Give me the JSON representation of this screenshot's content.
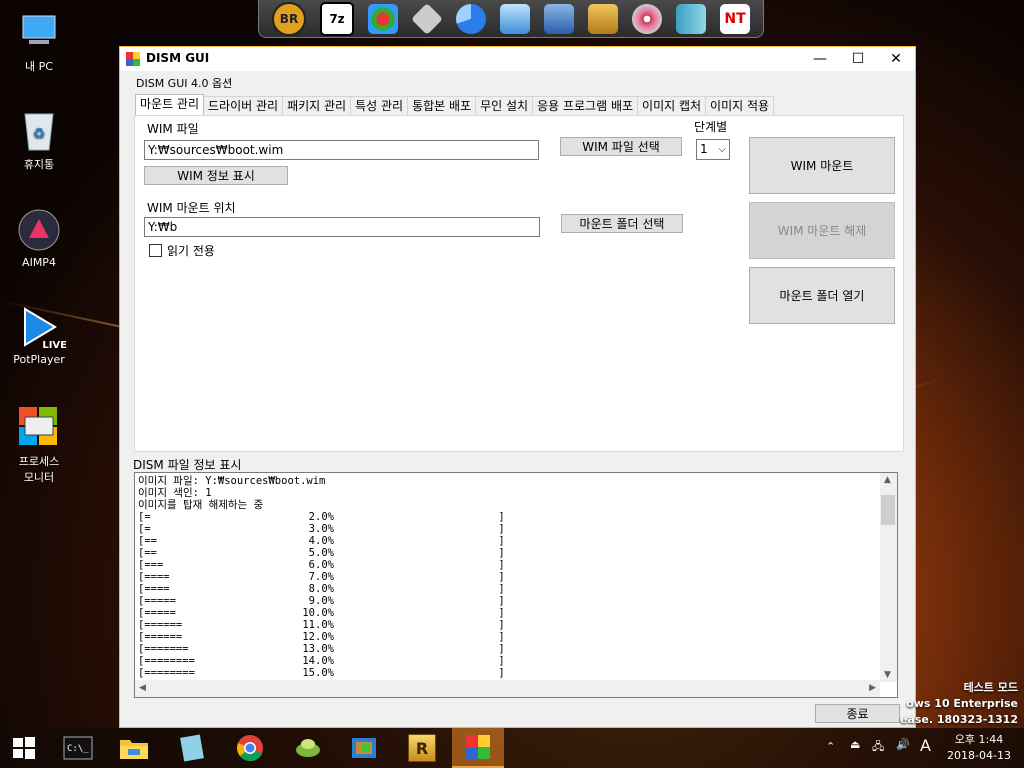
{
  "desktop": {
    "icons": [
      {
        "label": "내 PC",
        "icon": "this-pc-icon"
      },
      {
        "label": "휴지통",
        "icon": "recycle-bin-icon"
      },
      {
        "label": "AIMP4",
        "icon": "aimp-icon"
      },
      {
        "label": "PotPlayer",
        "icon": "potplayer-icon",
        "badge": "LIVE"
      },
      {
        "label": "프로세스\n모니터",
        "icon": "process-monitor-icon"
      }
    ]
  },
  "launcher": {
    "items": [
      {
        "icon": "br-icon",
        "text": "BR"
      },
      {
        "icon": "7zip-icon",
        "text": "7z"
      },
      {
        "icon": "partition-icon",
        "text": ""
      },
      {
        "icon": "disk-tool-icon",
        "text": ""
      },
      {
        "icon": "pie-chart-icon",
        "text": ""
      },
      {
        "icon": "setup-icon",
        "text": ""
      },
      {
        "icon": "network-tool-icon",
        "text": ""
      },
      {
        "icon": "archive-box-icon",
        "text": ""
      },
      {
        "icon": "disc-icon",
        "text": ""
      },
      {
        "icon": "book-icon",
        "text": ""
      },
      {
        "icon": "nt-icon",
        "text": "NT"
      }
    ]
  },
  "window": {
    "title": "DISM GUI",
    "menu_options": "DISM GUI 4.0 옵션",
    "tabs": [
      {
        "label": "마운트 관리",
        "active": true
      },
      {
        "label": "드라이버 관리"
      },
      {
        "label": "패키지 관리"
      },
      {
        "label": "특성 관리"
      },
      {
        "label": "통합본 배포"
      },
      {
        "label": "무인 설치"
      },
      {
        "label": "응용 프로그램 배포"
      },
      {
        "label": "이미지 캡처"
      },
      {
        "label": "이미지 적용"
      }
    ],
    "mount": {
      "wim_file_label": "WIM 파일",
      "wim_file_value": "Y:₩sources₩boot.wim",
      "select_wim_button": "WIM 파일 선택",
      "index_label": "단계별",
      "index_value": "1",
      "wim_info_button": "WIM 정보 표시",
      "mount_location_label": "WIM 마운트 위치",
      "mount_location_value": "Y:₩b",
      "select_mount_folder_button": "마운트 폴더 선택",
      "readonly_label": "읽기 전용",
      "readonly_checked": false,
      "mount_button": "WIM 마운트",
      "unmount_button": "WIM 마운트 해제",
      "open_mount_folder_button": "마운트 폴더 열기"
    },
    "info_label": "DISM 파일 정보 표시",
    "info_lines": [
      "이미지 파일: Y:₩sources₩boot.wim",
      "이미지 색인: 1",
      "이미지를 탑재 해제하는 중",
      "[=                         2.0%                          ]",
      "[=                         3.0%                          ]",
      "[==                        4.0%                          ]",
      "[==                        5.0%                          ]",
      "[===                       6.0%                          ]",
      "[====                      7.0%                          ]",
      "[====                      8.0%                          ]",
      "[=====                     9.0%                          ]",
      "[=====                    10.0%                          ]",
      "[======                   11.0%                          ]",
      "[======                   12.0%                          ]",
      "[=======                  13.0%                          ]",
      "[========                 14.0%                          ]",
      "[========                 15.0%                          ]"
    ],
    "close_button": "종료"
  },
  "watermark": {
    "line1": "테스트 모드",
    "line2": "ows 10 Enterprise",
    "line3": "ease. 180323-1312"
  },
  "taskbar": {
    "items": [
      {
        "icon": "start-icon"
      },
      {
        "icon": "cmd-icon"
      },
      {
        "icon": "file-explorer-icon"
      },
      {
        "icon": "notepad-icon"
      },
      {
        "icon": "chrome-icon"
      },
      {
        "icon": "leaf-app-icon"
      },
      {
        "icon": "paint-icon"
      },
      {
        "icon": "r-app-icon",
        "text": "R"
      },
      {
        "icon": "dism-gui-icon",
        "active": true
      }
    ],
    "tray": {
      "ime": "A",
      "time": "오후 1:44",
      "date": "2018-04-13"
    }
  }
}
